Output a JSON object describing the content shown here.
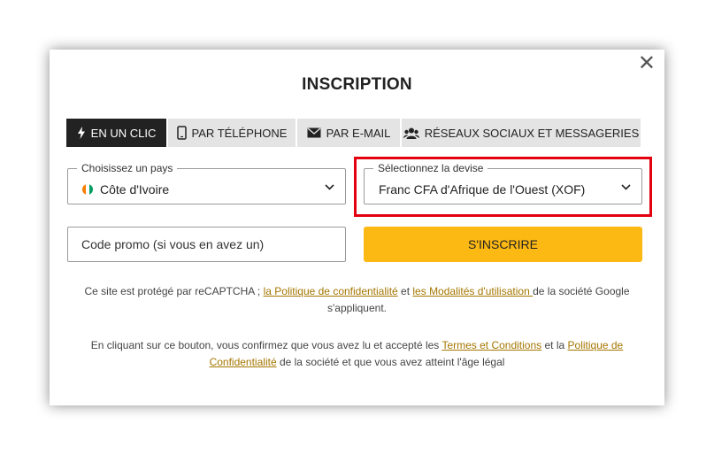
{
  "modal": {
    "title": "INSCRIPTION",
    "close_symbol": "✕"
  },
  "tabs": [
    {
      "label": "EN UN CLIC",
      "icon": "lightning-icon",
      "active": true
    },
    {
      "label": "PAR TÉLÉPHONE",
      "icon": "phone-icon",
      "active": false
    },
    {
      "label": "PAR E-MAIL",
      "icon": "envelope-icon",
      "active": false
    },
    {
      "label": "RÉSEAUX SOCIAUX ET MESSAGERIES",
      "icon": "users-icon",
      "active": false
    }
  ],
  "country": {
    "label": "Choisissez un pays",
    "value": "Côte d'Ivoire",
    "flag_colors": [
      "#f77f00",
      "#ffffff",
      "#009e60"
    ]
  },
  "currency": {
    "label": "Sélectionnez la devise",
    "value": "Franc CFA d'Afrique de l'Ouest (XOF)"
  },
  "promo": {
    "placeholder": "Code promo (si vous en avez un)"
  },
  "signup_button": "S'INSCRIRE",
  "recaptcha": {
    "prefix": "Ce site est protégé par reCAPTCHA ; ",
    "privacy_link": "la Politique de confidentialité",
    "and": " et ",
    "terms_link": "les Modalités d'utilisation ",
    "suffix": "de la société Google s'appliquent."
  },
  "consent": {
    "prefix": "En cliquant sur ce bouton, vous confirmez que vous avez lu et accepté les ",
    "terms_link": "Termes et Conditions",
    "and": " et la ",
    "privacy_link": "Politique de Confidentialité",
    "suffix": " de la société et que vous avez atteint l'âge légal"
  },
  "colors": {
    "accent": "#fdb913",
    "highlight": "#e3000f",
    "link": "#a47600"
  }
}
